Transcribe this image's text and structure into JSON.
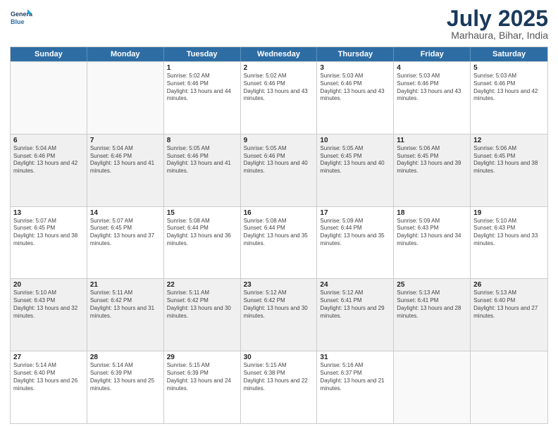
{
  "header": {
    "logo_line1": "General",
    "logo_line2": "Blue",
    "month": "July 2025",
    "location": "Marhaura, Bihar, India"
  },
  "days_of_week": [
    "Sunday",
    "Monday",
    "Tuesday",
    "Wednesday",
    "Thursday",
    "Friday",
    "Saturday"
  ],
  "rows": [
    [
      {
        "day": "",
        "info": "",
        "empty": true
      },
      {
        "day": "",
        "info": "",
        "empty": true
      },
      {
        "day": "1",
        "info": "Sunrise: 5:02 AM\nSunset: 6:46 PM\nDaylight: 13 hours and 44 minutes.",
        "empty": false
      },
      {
        "day": "2",
        "info": "Sunrise: 5:02 AM\nSunset: 6:46 PM\nDaylight: 13 hours and 43 minutes.",
        "empty": false
      },
      {
        "day": "3",
        "info": "Sunrise: 5:03 AM\nSunset: 6:46 PM\nDaylight: 13 hours and 43 minutes.",
        "empty": false
      },
      {
        "day": "4",
        "info": "Sunrise: 5:03 AM\nSunset: 6:46 PM\nDaylight: 13 hours and 43 minutes.",
        "empty": false
      },
      {
        "day": "5",
        "info": "Sunrise: 5:03 AM\nSunset: 6:46 PM\nDaylight: 13 hours and 42 minutes.",
        "empty": false
      }
    ],
    [
      {
        "day": "6",
        "info": "Sunrise: 5:04 AM\nSunset: 6:46 PM\nDaylight: 13 hours and 42 minutes.",
        "empty": false
      },
      {
        "day": "7",
        "info": "Sunrise: 5:04 AM\nSunset: 6:46 PM\nDaylight: 13 hours and 41 minutes.",
        "empty": false
      },
      {
        "day": "8",
        "info": "Sunrise: 5:05 AM\nSunset: 6:46 PM\nDaylight: 13 hours and 41 minutes.",
        "empty": false
      },
      {
        "day": "9",
        "info": "Sunrise: 5:05 AM\nSunset: 6:46 PM\nDaylight: 13 hours and 40 minutes.",
        "empty": false
      },
      {
        "day": "10",
        "info": "Sunrise: 5:05 AM\nSunset: 6:45 PM\nDaylight: 13 hours and 40 minutes.",
        "empty": false
      },
      {
        "day": "11",
        "info": "Sunrise: 5:06 AM\nSunset: 6:45 PM\nDaylight: 13 hours and 39 minutes.",
        "empty": false
      },
      {
        "day": "12",
        "info": "Sunrise: 5:06 AM\nSunset: 6:45 PM\nDaylight: 13 hours and 38 minutes.",
        "empty": false
      }
    ],
    [
      {
        "day": "13",
        "info": "Sunrise: 5:07 AM\nSunset: 6:45 PM\nDaylight: 13 hours and 38 minutes.",
        "empty": false
      },
      {
        "day": "14",
        "info": "Sunrise: 5:07 AM\nSunset: 6:45 PM\nDaylight: 13 hours and 37 minutes.",
        "empty": false
      },
      {
        "day": "15",
        "info": "Sunrise: 5:08 AM\nSunset: 6:44 PM\nDaylight: 13 hours and 36 minutes.",
        "empty": false
      },
      {
        "day": "16",
        "info": "Sunrise: 5:08 AM\nSunset: 6:44 PM\nDaylight: 13 hours and 35 minutes.",
        "empty": false
      },
      {
        "day": "17",
        "info": "Sunrise: 5:09 AM\nSunset: 6:44 PM\nDaylight: 13 hours and 35 minutes.",
        "empty": false
      },
      {
        "day": "18",
        "info": "Sunrise: 5:09 AM\nSunset: 6:43 PM\nDaylight: 13 hours and 34 minutes.",
        "empty": false
      },
      {
        "day": "19",
        "info": "Sunrise: 5:10 AM\nSunset: 6:43 PM\nDaylight: 13 hours and 33 minutes.",
        "empty": false
      }
    ],
    [
      {
        "day": "20",
        "info": "Sunrise: 5:10 AM\nSunset: 6:43 PM\nDaylight: 13 hours and 32 minutes.",
        "empty": false
      },
      {
        "day": "21",
        "info": "Sunrise: 5:11 AM\nSunset: 6:42 PM\nDaylight: 13 hours and 31 minutes.",
        "empty": false
      },
      {
        "day": "22",
        "info": "Sunrise: 5:11 AM\nSunset: 6:42 PM\nDaylight: 13 hours and 30 minutes.",
        "empty": false
      },
      {
        "day": "23",
        "info": "Sunrise: 5:12 AM\nSunset: 6:42 PM\nDaylight: 13 hours and 30 minutes.",
        "empty": false
      },
      {
        "day": "24",
        "info": "Sunrise: 5:12 AM\nSunset: 6:41 PM\nDaylight: 13 hours and 29 minutes.",
        "empty": false
      },
      {
        "day": "25",
        "info": "Sunrise: 5:13 AM\nSunset: 6:41 PM\nDaylight: 13 hours and 28 minutes.",
        "empty": false
      },
      {
        "day": "26",
        "info": "Sunrise: 5:13 AM\nSunset: 6:40 PM\nDaylight: 13 hours and 27 minutes.",
        "empty": false
      }
    ],
    [
      {
        "day": "27",
        "info": "Sunrise: 5:14 AM\nSunset: 6:40 PM\nDaylight: 13 hours and 26 minutes.",
        "empty": false
      },
      {
        "day": "28",
        "info": "Sunrise: 5:14 AM\nSunset: 6:39 PM\nDaylight: 13 hours and 25 minutes.",
        "empty": false
      },
      {
        "day": "29",
        "info": "Sunrise: 5:15 AM\nSunset: 6:39 PM\nDaylight: 13 hours and 24 minutes.",
        "empty": false
      },
      {
        "day": "30",
        "info": "Sunrise: 5:15 AM\nSunset: 6:38 PM\nDaylight: 13 hours and 22 minutes.",
        "empty": false
      },
      {
        "day": "31",
        "info": "Sunrise: 5:16 AM\nSunset: 6:37 PM\nDaylight: 13 hours and 21 minutes.",
        "empty": false
      },
      {
        "day": "",
        "info": "",
        "empty": true
      },
      {
        "day": "",
        "info": "",
        "empty": true
      }
    ]
  ]
}
